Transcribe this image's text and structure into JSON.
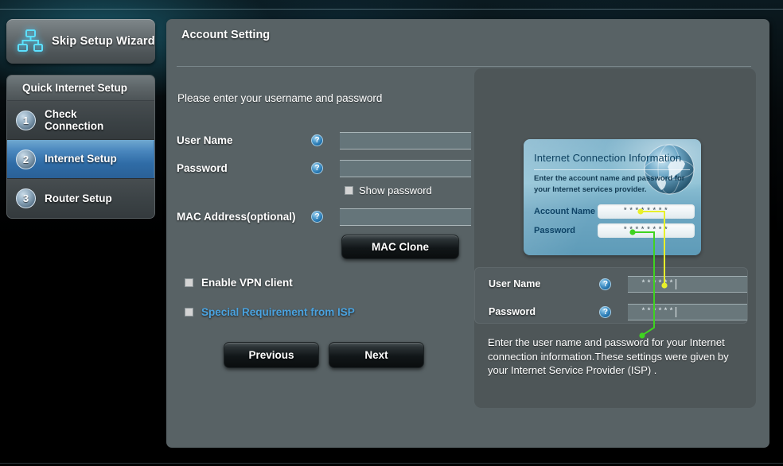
{
  "sidebar": {
    "skip_button": {
      "label": "Skip Setup Wizard",
      "icon": "network-topology-icon"
    },
    "nav_title": "Quick Internet Setup",
    "items": [
      {
        "number": "1",
        "label": "Check\nConnection",
        "active": false
      },
      {
        "number": "2",
        "label": "Internet Setup",
        "active": true
      },
      {
        "number": "3",
        "label": "Router Setup",
        "active": false
      }
    ]
  },
  "main": {
    "title": "Account Setting",
    "intro": "Please enter your username and password",
    "fields": [
      {
        "label": "User Name",
        "value": "",
        "placeholder": "",
        "help": "?"
      },
      {
        "label": "Password",
        "value": "",
        "placeholder": "",
        "help": "?"
      },
      {
        "label": "MAC Address(optional)",
        "value": "",
        "placeholder": "",
        "help": "?"
      }
    ],
    "show_password": {
      "label": "Show password",
      "checked": false
    },
    "mac_clone_button": "MAC Clone",
    "options": [
      {
        "label": "Enable VPN client",
        "checked": false,
        "link": false
      },
      {
        "label": "Special Requirement from ISP",
        "checked": false,
        "link": true
      }
    ],
    "previous_button": "Previous",
    "next_button": "Next"
  },
  "help": {
    "card": {
      "title": "Internet Connection Information",
      "subtitle": "Enter the account name and password for your Internet services provider.",
      "rows": [
        {
          "label": "Account Name",
          "value": "********"
        },
        {
          "label": "Password",
          "value": "********"
        }
      ]
    },
    "fields": [
      {
        "label": "User Name",
        "value": "******",
        "help": "?"
      },
      {
        "label": "Password",
        "value": "******",
        "help": "?"
      }
    ],
    "description": "Enter the user name and password for your Internet connection information.These settings were given by your Internet Service Provider (ISP) ."
  },
  "colors": {
    "panel_bg": "#586265",
    "help_bg": "#4e5658",
    "accent_blue": "#4aa3e0",
    "active_nav": "#2f6ca6",
    "callout_yellow": "#e8f02a",
    "callout_green": "#3fd320",
    "card_blue": "#7fb3cb"
  }
}
